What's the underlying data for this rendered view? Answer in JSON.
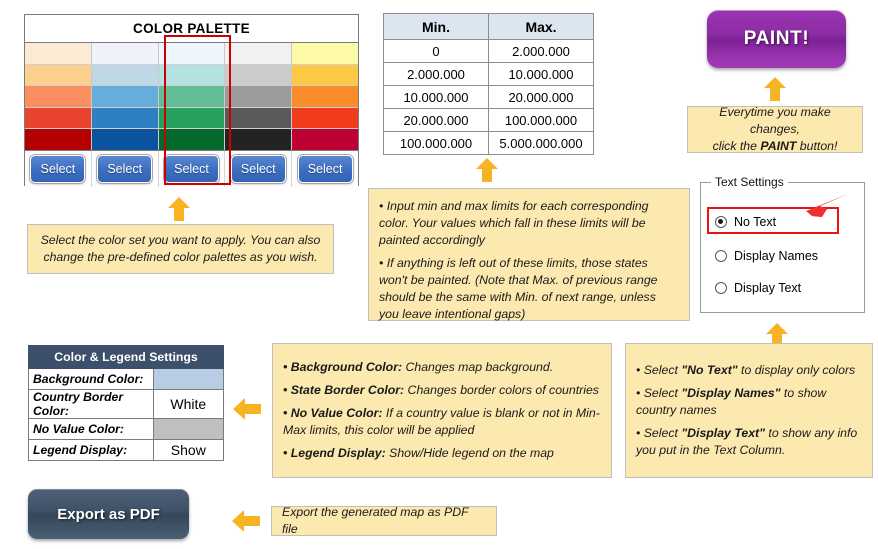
{
  "palette": {
    "title": "COLOR PALETTE",
    "select_label": "Select",
    "selected_index": 2,
    "columns": [
      {
        "name": "orange-red-palette",
        "colors": [
          "#FBEBD4",
          "#FCCF8C",
          "#FB8E5E",
          "#E8432C",
          "#B40000"
        ]
      },
      {
        "name": "blue-palette",
        "colors": [
          "#EEF3FB",
          "#BFD8E8",
          "#66ADDC",
          "#2E80C0",
          "#0B539F"
        ]
      },
      {
        "name": "green-palette",
        "colors": [
          "#EDF6FB",
          "#B3E2E0",
          "#62BC96",
          "#27A15E",
          "#046A2B"
        ]
      },
      {
        "name": "gray-palette",
        "colors": [
          "#F2F0F2",
          "#CBCBCB",
          "#9B9B9B",
          "#5A5A5A",
          "#232323"
        ]
      },
      {
        "name": "yellow-crimson-palette",
        "colors": [
          "#FDFBA8",
          "#FDC944",
          "#FB8C2A",
          "#F03B1C",
          "#BE0133"
        ]
      }
    ]
  },
  "minmax": {
    "headers": [
      "Min.",
      "Max."
    ],
    "rows": [
      [
        "0",
        "2.000.000"
      ],
      [
        "2.000.000",
        "10.000.000"
      ],
      [
        "10.000.000",
        "20.000.000"
      ],
      [
        "20.000.000",
        "100.000.000"
      ],
      [
        "100.000.000",
        "5.000.000.000"
      ]
    ]
  },
  "paint_button": {
    "label": "PAINT!",
    "color": "#8E2DA6"
  },
  "export_button": {
    "label": "Export as PDF",
    "color": "#3F5267"
  },
  "text_settings": {
    "legend": "Text Settings",
    "options": [
      {
        "label": "No Text",
        "checked": true
      },
      {
        "label": "Display Names",
        "checked": false
      },
      {
        "label": "Display Text",
        "checked": false
      }
    ],
    "highlight_color": "#EE1111",
    "pointer_color": "#F03030"
  },
  "color_legend_settings": {
    "title": "Color & Legend Settings",
    "rows": [
      {
        "label": "Background Color:",
        "value": "",
        "swatch": "#B8CCE4"
      },
      {
        "label": "Country Border Color:",
        "value": "White",
        "swatch": ""
      },
      {
        "label": "No Value Color:",
        "value": "",
        "swatch": "#BFBFBF"
      },
      {
        "label": "Legend Display:",
        "value": "Show",
        "swatch": ""
      }
    ]
  },
  "notes": {
    "palette": {
      "line1": "Select the color set you want to apply. You can also",
      "line2": "change the pre-defined color palettes as you wish."
    },
    "minmax": {
      "bullet1": "• Input min and max limits for each corresponding color. Your values which fall in these limits will be painted accordingly",
      "bullet2": "• If anything is left out of these limits, those states won't be painted. (Note that Max. of previous range should be the same with Min. of next range, unless you leave intentional gaps)"
    },
    "paint": {
      "line1": "Everytime you make changes,",
      "line2_pre": "click the ",
      "line2_bold": "PAINT",
      "line2_post": " button!"
    },
    "color_legend": {
      "b1_bold": "• Background Color:",
      "b1_text": " Changes map background.",
      "b2_bold": "• State Border Color:",
      "b2_text": " Changes border colors of countries",
      "b3_bold": "• No Value Color:",
      "b3_text": " If a country value is blank or not in Min-Max limits, this color will be applied",
      "b4_bold": "• Legend Display:",
      "b4_text": " Show/Hide legend on the map"
    },
    "text_settings": {
      "b1_pre": "• Select ",
      "b1_bold": "\"No Text\"",
      "b1_post": " to display only colors",
      "b2_pre": "• Select ",
      "b2_bold": "\"Display Names\"",
      "b2_post": " to show country names",
      "b3_pre": "• Select ",
      "b3_bold": "\"Display Text\"",
      "b3_post": " to show any info you put in the Text Column."
    },
    "export": "Export the generated map as PDF file"
  },
  "arrow_color": "#F8B323"
}
